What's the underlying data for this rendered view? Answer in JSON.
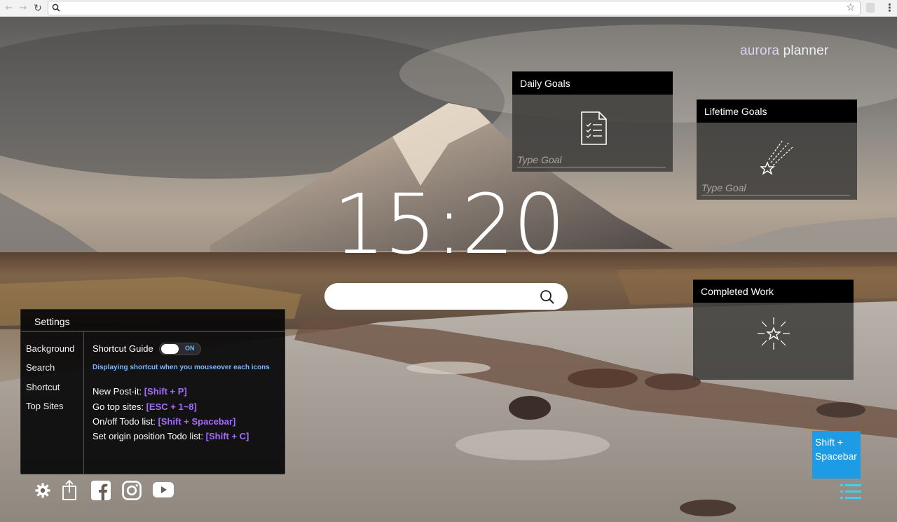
{
  "browser": {
    "back_glyph": "←",
    "forward_glyph": "→",
    "reload_glyph": "↻",
    "address_value": "",
    "star_glyph": "☆",
    "menu_glyph": "⋮"
  },
  "brand": {
    "part1": "aurora",
    "part2": " planner"
  },
  "clock": {
    "time": "15:20"
  },
  "search": {
    "value": "",
    "placeholder": ""
  },
  "daily_goals": {
    "title": "Daily Goals",
    "placeholder": "Type Goal",
    "icon": "checklist-document-icon"
  },
  "lifetime_goals": {
    "title": "Lifetime Goals",
    "placeholder": "Type Goal",
    "icon": "shooting-star-icon"
  },
  "completed_work": {
    "title": "Completed Work",
    "icon": "firework-star-icon"
  },
  "settings": {
    "title": "Settings",
    "nav": [
      "Background",
      "Search",
      "Shortcut",
      "Top Sites"
    ],
    "shortcut_guide_label": "Shortcut Guide",
    "toggle_state": "ON",
    "toggle_on": true,
    "hint": "Displaying shortcut when you mouseover each icons",
    "shortcuts": [
      {
        "label": "New Post-it: ",
        "key": "[Shift + P]"
      },
      {
        "label": "Go top sites: ",
        "key": "[ESC + 1~8]"
      },
      {
        "label": "On/off Todo list: ",
        "key": "[Shift + Spacebar]"
      },
      {
        "label": "Set origin position Todo list: ",
        "key": "[Shift + C]"
      }
    ]
  },
  "bottom_icons": [
    "gear-icon",
    "share-icon",
    "facebook-icon",
    "instagram-icon",
    "youtube-icon"
  ],
  "todo_shortcut": {
    "line1": "Shift  +",
    "line2": "Spacebar"
  },
  "colors": {
    "accent_blue": "#1d9be5",
    "shortcut_key": "#a46bff",
    "hint_blue": "#79b6ff",
    "list_icon": "#3fd0f0"
  }
}
